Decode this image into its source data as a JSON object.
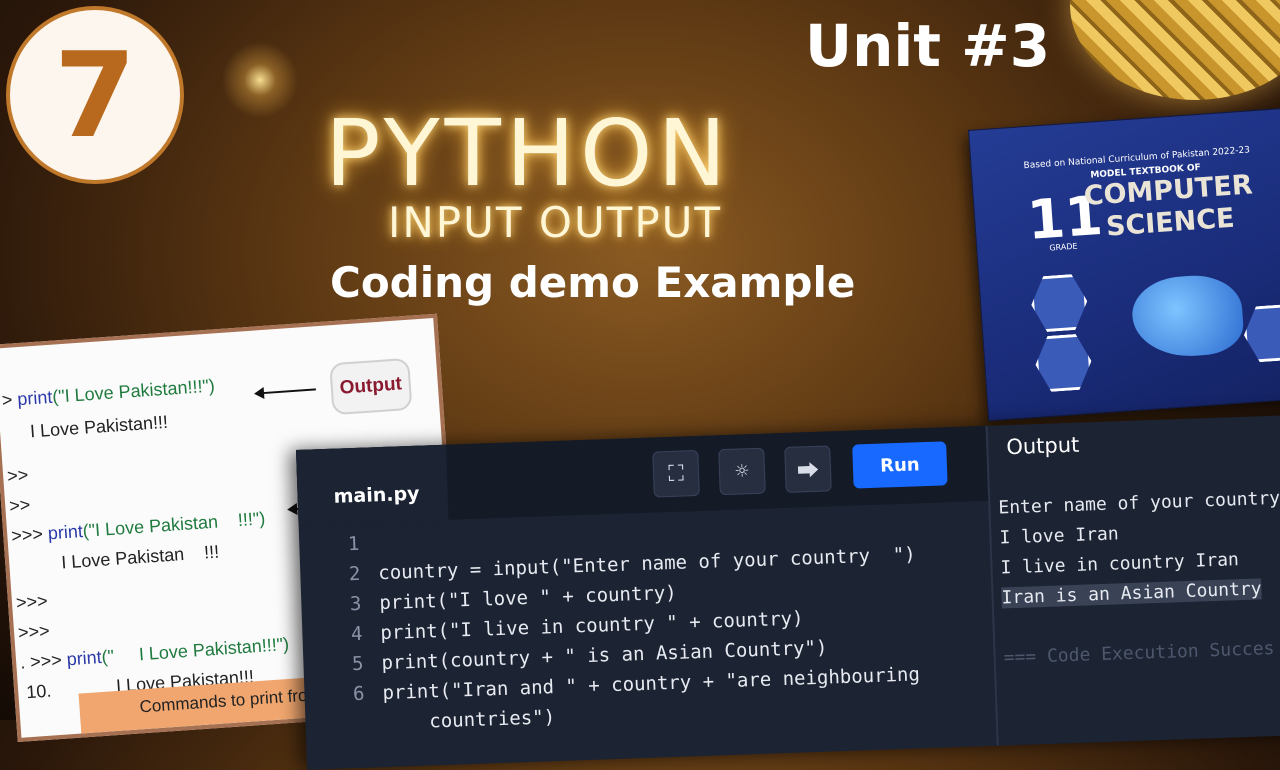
{
  "badge": {
    "number": "7"
  },
  "unit_label": "Unit #3",
  "titles": {
    "main": "PYTHON",
    "sub": "INPUT OUTPUT",
    "tagline": "Coding demo Example"
  },
  "book": {
    "based_on": "Based on National Curriculum of Pakistan 2022-23",
    "model": "MODEL TEXTBOOK OF",
    "grade": "11",
    "grade_label": "GRADE",
    "subject_line1": "COMPUTER",
    "subject_line2": "SCIENCE"
  },
  "board": {
    "output_button": "Output",
    "lines": [
      {
        "prompt": "> ",
        "kw": "print",
        "str": "(\"I Love Pakistan!!!\")"
      },
      {
        "text": "I Love Pakistan!!!"
      },
      {
        "text": ">>"
      },
      {
        "text": ">>"
      },
      {
        "prompt": ">>> ",
        "kw": "print",
        "str": "(\"I Love Pakistan    !!!\")"
      },
      {
        "text": "I Love Pakistan    !!!"
      },
      {
        "text": ">>>"
      },
      {
        "text": ">>>"
      },
      {
        "prompt": ". >>> ",
        "kw": "print",
        "str": "(\"     I Love Pakistan!!!\")"
      },
      {
        "text": "I Love Pakistan!!!"
      }
    ],
    "line_number": "10.",
    "footer_text": "Commands to print from"
  },
  "ide": {
    "tab_label": "main.py",
    "icons": [
      "fullscreen-icon",
      "sun-icon",
      "share-icon"
    ],
    "run_label": "Run",
    "output_title": "Output",
    "code_lines": [
      {
        "num": "1",
        "code": ""
      },
      {
        "num": "2",
        "code": "country = input(\"Enter name of your country  \")"
      },
      {
        "num": "3",
        "code": "print(\"I love \" + country)"
      },
      {
        "num": "4",
        "code": "print(\"I live in country \" + country)"
      },
      {
        "num": "5",
        "code": "print(country + \" is an Asian Country\")"
      },
      {
        "num": "6",
        "code": "print(\"Iran and \" + country + \"are neighbouring"
      },
      {
        "num": "",
        "code": "    countries\")"
      }
    ],
    "output_lines": [
      "Enter name of your country",
      "I love Iran",
      "I live in country Iran",
      "Iran is an Asian Country",
      "",
      "=== Code Execution Succes"
    ]
  }
}
